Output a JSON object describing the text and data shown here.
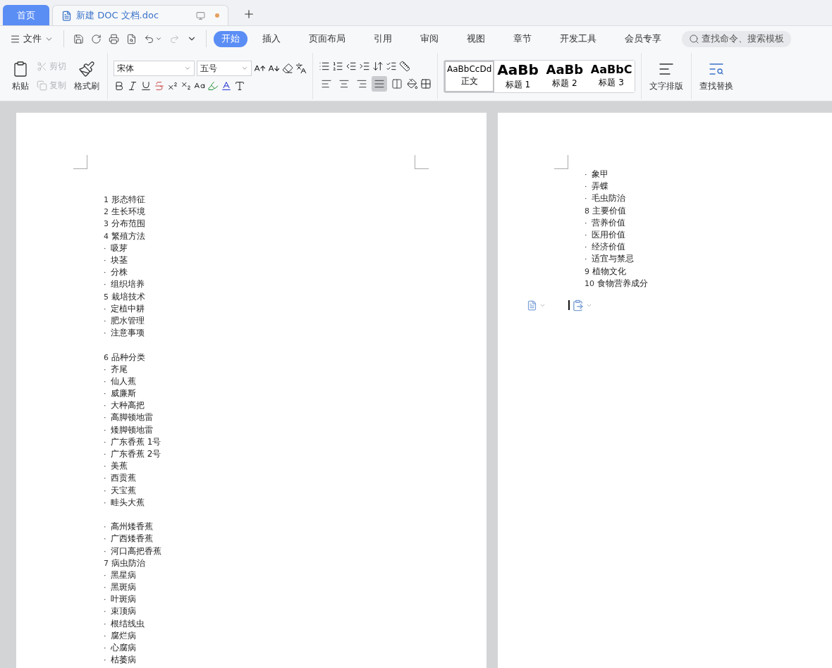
{
  "tabs": [
    {
      "label": "首页",
      "kind": "home",
      "selected": false
    },
    {
      "label": "新建 DOC 文档.doc",
      "kind": "doc",
      "selected": true
    }
  ],
  "menu": {
    "file": "文件",
    "ribbon_tabs": [
      {
        "label": "开始",
        "selected": true
      },
      {
        "label": "插入",
        "selected": false
      },
      {
        "label": "页面布局",
        "selected": false
      },
      {
        "label": "引用",
        "selected": false
      },
      {
        "label": "审阅",
        "selected": false
      },
      {
        "label": "视图",
        "selected": false
      },
      {
        "label": "章节",
        "selected": false
      },
      {
        "label": "开发工具",
        "selected": false
      },
      {
        "label": "会员专享",
        "selected": false
      }
    ],
    "search": {
      "placeholder": "查找命令、搜索模板"
    }
  },
  "ribbon": {
    "paste": "粘贴",
    "cut": {
      "label": "剪切",
      "disabled": true
    },
    "copy": {
      "label": "复制",
      "disabled": true
    },
    "format_painter": "格式刷",
    "font": "宋体",
    "size": "五号",
    "align": [
      {
        "kind": "left",
        "selected": false
      },
      {
        "kind": "center",
        "selected": false
      },
      {
        "kind": "right",
        "selected": false
      },
      {
        "kind": "justify",
        "selected": true
      },
      {
        "kind": "distributed",
        "selected": false
      }
    ],
    "styles": [
      {
        "preview": "AaBbCcDd",
        "label": "正文",
        "kind": "body",
        "selected": true
      },
      {
        "preview": "AaBb",
        "label": "标题 1",
        "kind": "h1",
        "selected": false
      },
      {
        "preview": "AaBb",
        "label": "标题 2",
        "kind": "h2",
        "selected": false
      },
      {
        "preview": "AaBbC",
        "label": "标题 3",
        "kind": "h3",
        "selected": false
      }
    ],
    "text_layout": "文字排版",
    "find_replace": "查找替换"
  },
  "pages": [
    {
      "lines": [
        {
          "marker": "1",
          "text": "形态特征",
          "space_before": false
        },
        {
          "marker": "2",
          "text": "生长环境",
          "space_before": false
        },
        {
          "marker": "3",
          "text": "分布范围",
          "space_before": false
        },
        {
          "marker": "4",
          "text": "繁殖方法",
          "space_before": false
        },
        {
          "marker": "·",
          "text": "吸芽",
          "space_before": false
        },
        {
          "marker": "·",
          "text": "块茎",
          "space_before": false
        },
        {
          "marker": "·",
          "text": "分株",
          "space_before": false
        },
        {
          "marker": "·",
          "text": "组织培养",
          "space_before": false
        },
        {
          "marker": "5",
          "text": "栽培技术",
          "space_before": false
        },
        {
          "marker": "·",
          "text": "定植中耕",
          "space_before": false
        },
        {
          "marker": "·",
          "text": "肥水管理",
          "space_before": false
        },
        {
          "marker": "·",
          "text": "注意事项",
          "space_before": false
        },
        {
          "marker": "6",
          "text": "品种分类",
          "space_before": true
        },
        {
          "marker": "·",
          "text": "齐尾",
          "space_before": false
        },
        {
          "marker": "·",
          "text": "仙人蕉",
          "space_before": false
        },
        {
          "marker": "·",
          "text": "威廉斯",
          "space_before": false
        },
        {
          "marker": "·",
          "text": "大种高把",
          "space_before": false
        },
        {
          "marker": "·",
          "text": "高脚顿地雷",
          "space_before": false
        },
        {
          "marker": "·",
          "text": "矮脚顿地雷",
          "space_before": false
        },
        {
          "marker": "·",
          "text": "广东香蕉 1号",
          "space_before": false
        },
        {
          "marker": "·",
          "text": "广东香蕉 2号",
          "space_before": false
        },
        {
          "marker": "·",
          "text": "美蕉",
          "space_before": false
        },
        {
          "marker": "·",
          "text": "西贡蕉",
          "space_before": false
        },
        {
          "marker": "·",
          "text": "天宝蕉",
          "space_before": false
        },
        {
          "marker": "·",
          "text": "畦头大蕉",
          "space_before": false
        },
        {
          "marker": "·",
          "text": "高州矮香蕉",
          "space_before": true
        },
        {
          "marker": "·",
          "text": "广西矮香蕉",
          "space_before": false
        },
        {
          "marker": "·",
          "text": "河口高把香蕉",
          "space_before": false
        },
        {
          "marker": "7",
          "text": "病虫防治",
          "space_before": false
        },
        {
          "marker": "·",
          "text": "黑星病",
          "space_before": false
        },
        {
          "marker": "·",
          "text": "黑斑病",
          "space_before": false
        },
        {
          "marker": "·",
          "text": "叶斑病",
          "space_before": false
        },
        {
          "marker": "·",
          "text": "束顶病",
          "space_before": false
        },
        {
          "marker": "·",
          "text": "根结线虫",
          "space_before": false
        },
        {
          "marker": "·",
          "text": "腐烂病",
          "space_before": false
        },
        {
          "marker": "·",
          "text": "心腐病",
          "space_before": false
        },
        {
          "marker": "·",
          "text": "枯萎病",
          "space_before": false
        }
      ]
    },
    {
      "lines": [
        {
          "marker": "·",
          "text": "象甲",
          "space_before": false
        },
        {
          "marker": "·",
          "text": "弄蝶",
          "space_before": false
        },
        {
          "marker": "·",
          "text": "毛虫防治",
          "space_before": false
        },
        {
          "marker": "8",
          "text": "主要价值",
          "space_before": false
        },
        {
          "marker": "·",
          "text": "营养价值",
          "space_before": false
        },
        {
          "marker": "·",
          "text": "医用价值",
          "space_before": false
        },
        {
          "marker": "·",
          "text": "经济价值",
          "space_before": false
        },
        {
          "marker": "·",
          "text": "适宜与禁忌",
          "space_before": false
        },
        {
          "marker": "9",
          "text": "植物文化",
          "space_before": false
        },
        {
          "marker": "10",
          "text": "食物营养成分",
          "space_before": false
        }
      ]
    }
  ]
}
